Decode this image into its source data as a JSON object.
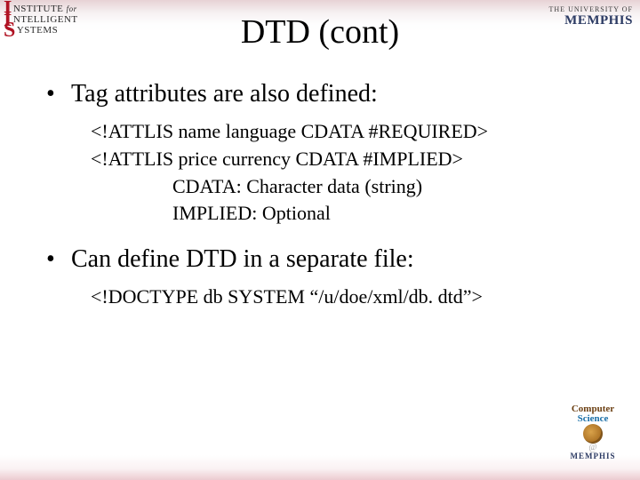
{
  "title": "DTD (cont)",
  "logos": {
    "left": {
      "line1_text": "NSTITUTE",
      "line1_for": "for",
      "line2_text": "NTELLIGENT",
      "line3_text": "YSTEMS"
    },
    "right": {
      "small": "THE UNIVERSITY OF",
      "big": "MEMPHIS"
    },
    "footer": {
      "cs_word1": "Computer",
      "cs_word2": "Science",
      "at": "@",
      "name": "MEMPHIS"
    }
  },
  "bullets": [
    {
      "text": "Tag attributes are also defined:",
      "code": [
        {
          "text": "<!ATTLIS name language CDATA #REQUIRED>",
          "sub": false
        },
        {
          "text": "<!ATTLIS price currency CDATA #IMPLIED>",
          "sub": false
        },
        {
          "text": "CDATA: Character data (string)",
          "sub": true
        },
        {
          "text": "IMPLIED: Optional",
          "sub": true
        }
      ]
    },
    {
      "text": "Can define DTD in a separate file:",
      "code": [
        {
          "text": "<!DOCTYPE db SYSTEM “/u/doe/xml/db. dtd”>",
          "sub": false
        }
      ]
    }
  ]
}
